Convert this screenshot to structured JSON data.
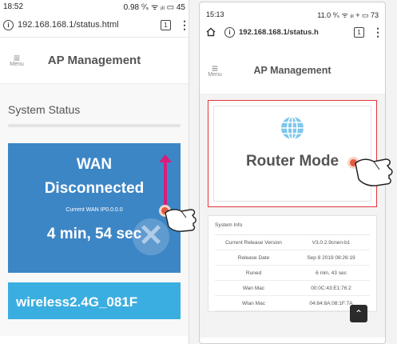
{
  "left_phone": {
    "status_bar": {
      "time": "18:52",
      "right": "0.98 ⁰⁄ₛ ᯤ ᵢₗₗ ▭ 45"
    },
    "address_bar": {
      "url": "192.168.168.1/status.html",
      "tab_count": "1"
    },
    "header": {
      "menu_label": "Menu",
      "title": "AP Management"
    },
    "section_title": "System Status",
    "wan_card": {
      "label": "WAN",
      "state": "Disconnected",
      "ip_text": "Current WAN IP0.0.0.0",
      "uptime": "4 min, 54 sec"
    },
    "wireless_card": {
      "ssid": "wireless2.4G_081F"
    }
  },
  "right_phone": {
    "status_bar": {
      "time": "15:13",
      "right": "11.0 ⁰⁄ₛ ᯤ ᵢₗₗ + ▭ 73"
    },
    "address_bar": {
      "url": "192.168.168.1/status.h",
      "tab_count": "1"
    },
    "header": {
      "menu_label": "Menu",
      "title": "AP Management"
    },
    "mode_card": {
      "label": "Router Mode"
    },
    "system_info": {
      "title": "System Info",
      "rows": [
        {
          "key": "Current Release Version",
          "value": "V3.0.2.9cnen-b1"
        },
        {
          "key": "Release Date",
          "value": "Sep 8 2019 08:26:19"
        },
        {
          "key": "Runed",
          "value": "6 min, 43 sec"
        },
        {
          "key": "Wan Mac",
          "value": "00:0C:43:E1:76:2"
        },
        {
          "key": "Wlan Mac",
          "value": "04:84:8A:08:1F:7A"
        }
      ]
    },
    "scroll_top_icon": "chevron-up-icon"
  },
  "colors": {
    "wan_card": "#3d86c6",
    "wireless_card": "#3aaee0",
    "swipe_arrow": "#d81c7a",
    "highlight_border": "#e2363a",
    "tap_dot": "#e25b3f"
  }
}
